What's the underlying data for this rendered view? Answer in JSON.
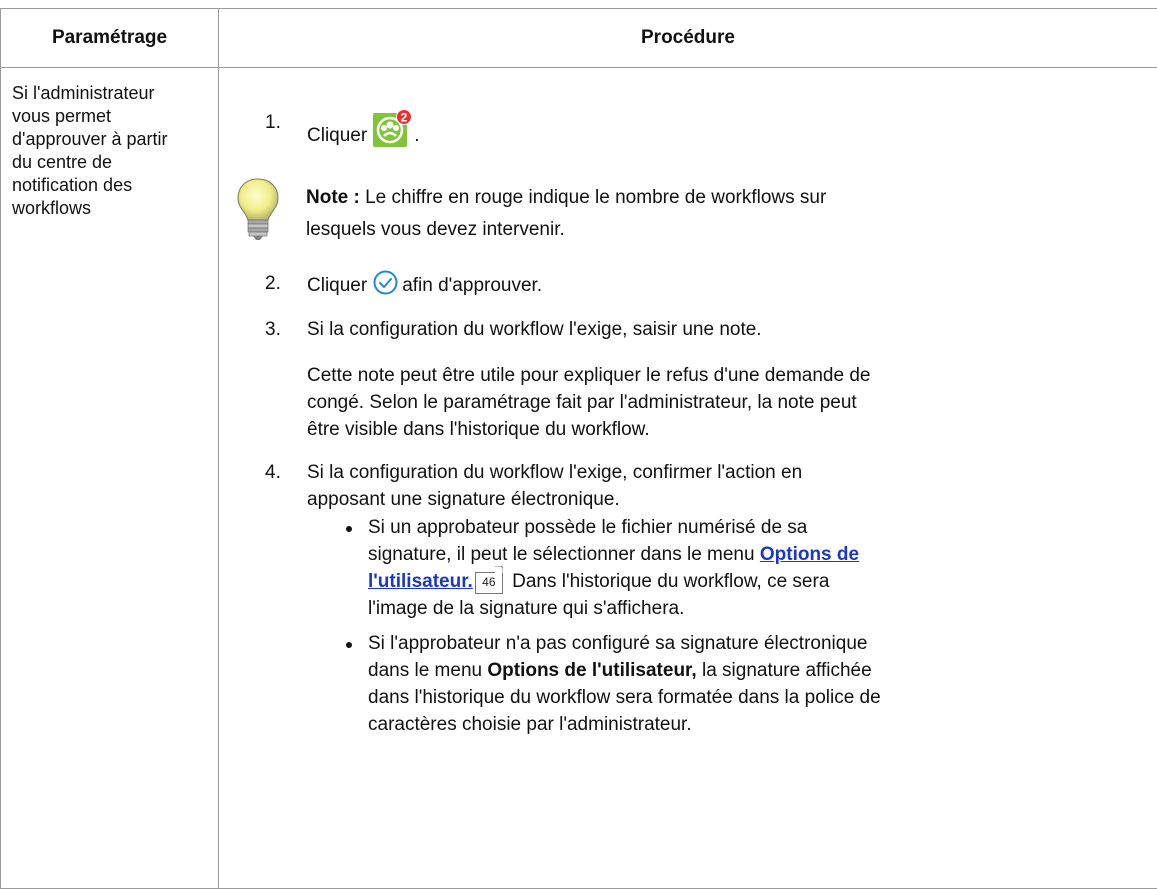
{
  "table": {
    "header_col1": "Paramétrage",
    "header_col2": "Procédure"
  },
  "left_cell": {
    "lines": [
      "Si l'administrateur",
      "vous permet",
      "d'approuver à partir",
      "du centre de",
      "notification des",
      "workflows"
    ]
  },
  "steps": {
    "s1": {
      "num": "1.",
      "text": "Cliquer",
      "after_icon": ".",
      "icon": "workflow-notification-icon",
      "badge_count": "2"
    },
    "note": {
      "label": "Note :",
      "text_line1": " Le chiffre en rouge indique le nombre de workflows sur",
      "text_line2": "lesquels vous devez intervenir.",
      "icon": "lightbulb-icon"
    },
    "s2": {
      "num": "2.",
      "text": "Cliquer",
      "after_icon": "afin d'approuver.",
      "icon": "approve-check-icon"
    },
    "s3": {
      "num": "3.",
      "text": "Si la configuration du workflow l'exige, saisir une note.",
      "para_line1": "Cette note peut être utile pour expliquer le refus d'une demande de",
      "para_line2": "congé. Selon le paramétrage fait par l'administrateur, la note peut",
      "para_line3": "être visible dans l'historique du workflow."
    },
    "s4": {
      "num": "4.",
      "line1": "Si la configuration du workflow l'exige, confirmer l'action en",
      "line2": "apposant une signature électronique.",
      "bullet1": {
        "line1": "Si un approbateur possède le fichier numérisé de sa",
        "line2_pre": "signature, il peut le sélectionner dans le menu ",
        "link_part1": "Options de",
        "link_part2": "l'utilisateur.",
        "page_ref": "46",
        "line3_post": " Dans l'historique du workflow, ce sera",
        "line4": "l'image de la signature qui s'affichera."
      },
      "bullet2": {
        "line1": "Si l'approbateur n'a pas configuré sa signature électronique",
        "line2_pre": "dans le menu ",
        "line2_bold": "Options de l'utilisateur,",
        "line2_post": " la signature affichée",
        "line3": "dans l'historique du workflow sera formatée dans la police de",
        "line4": "caractères choisie par l'administrateur."
      }
    }
  },
  "colors": {
    "border": "#9a9a9a",
    "link": "#1a38c8",
    "badge_red": "#e8312e",
    "icon_green": "#7fc43a",
    "check_blue": "#1e88d8"
  }
}
